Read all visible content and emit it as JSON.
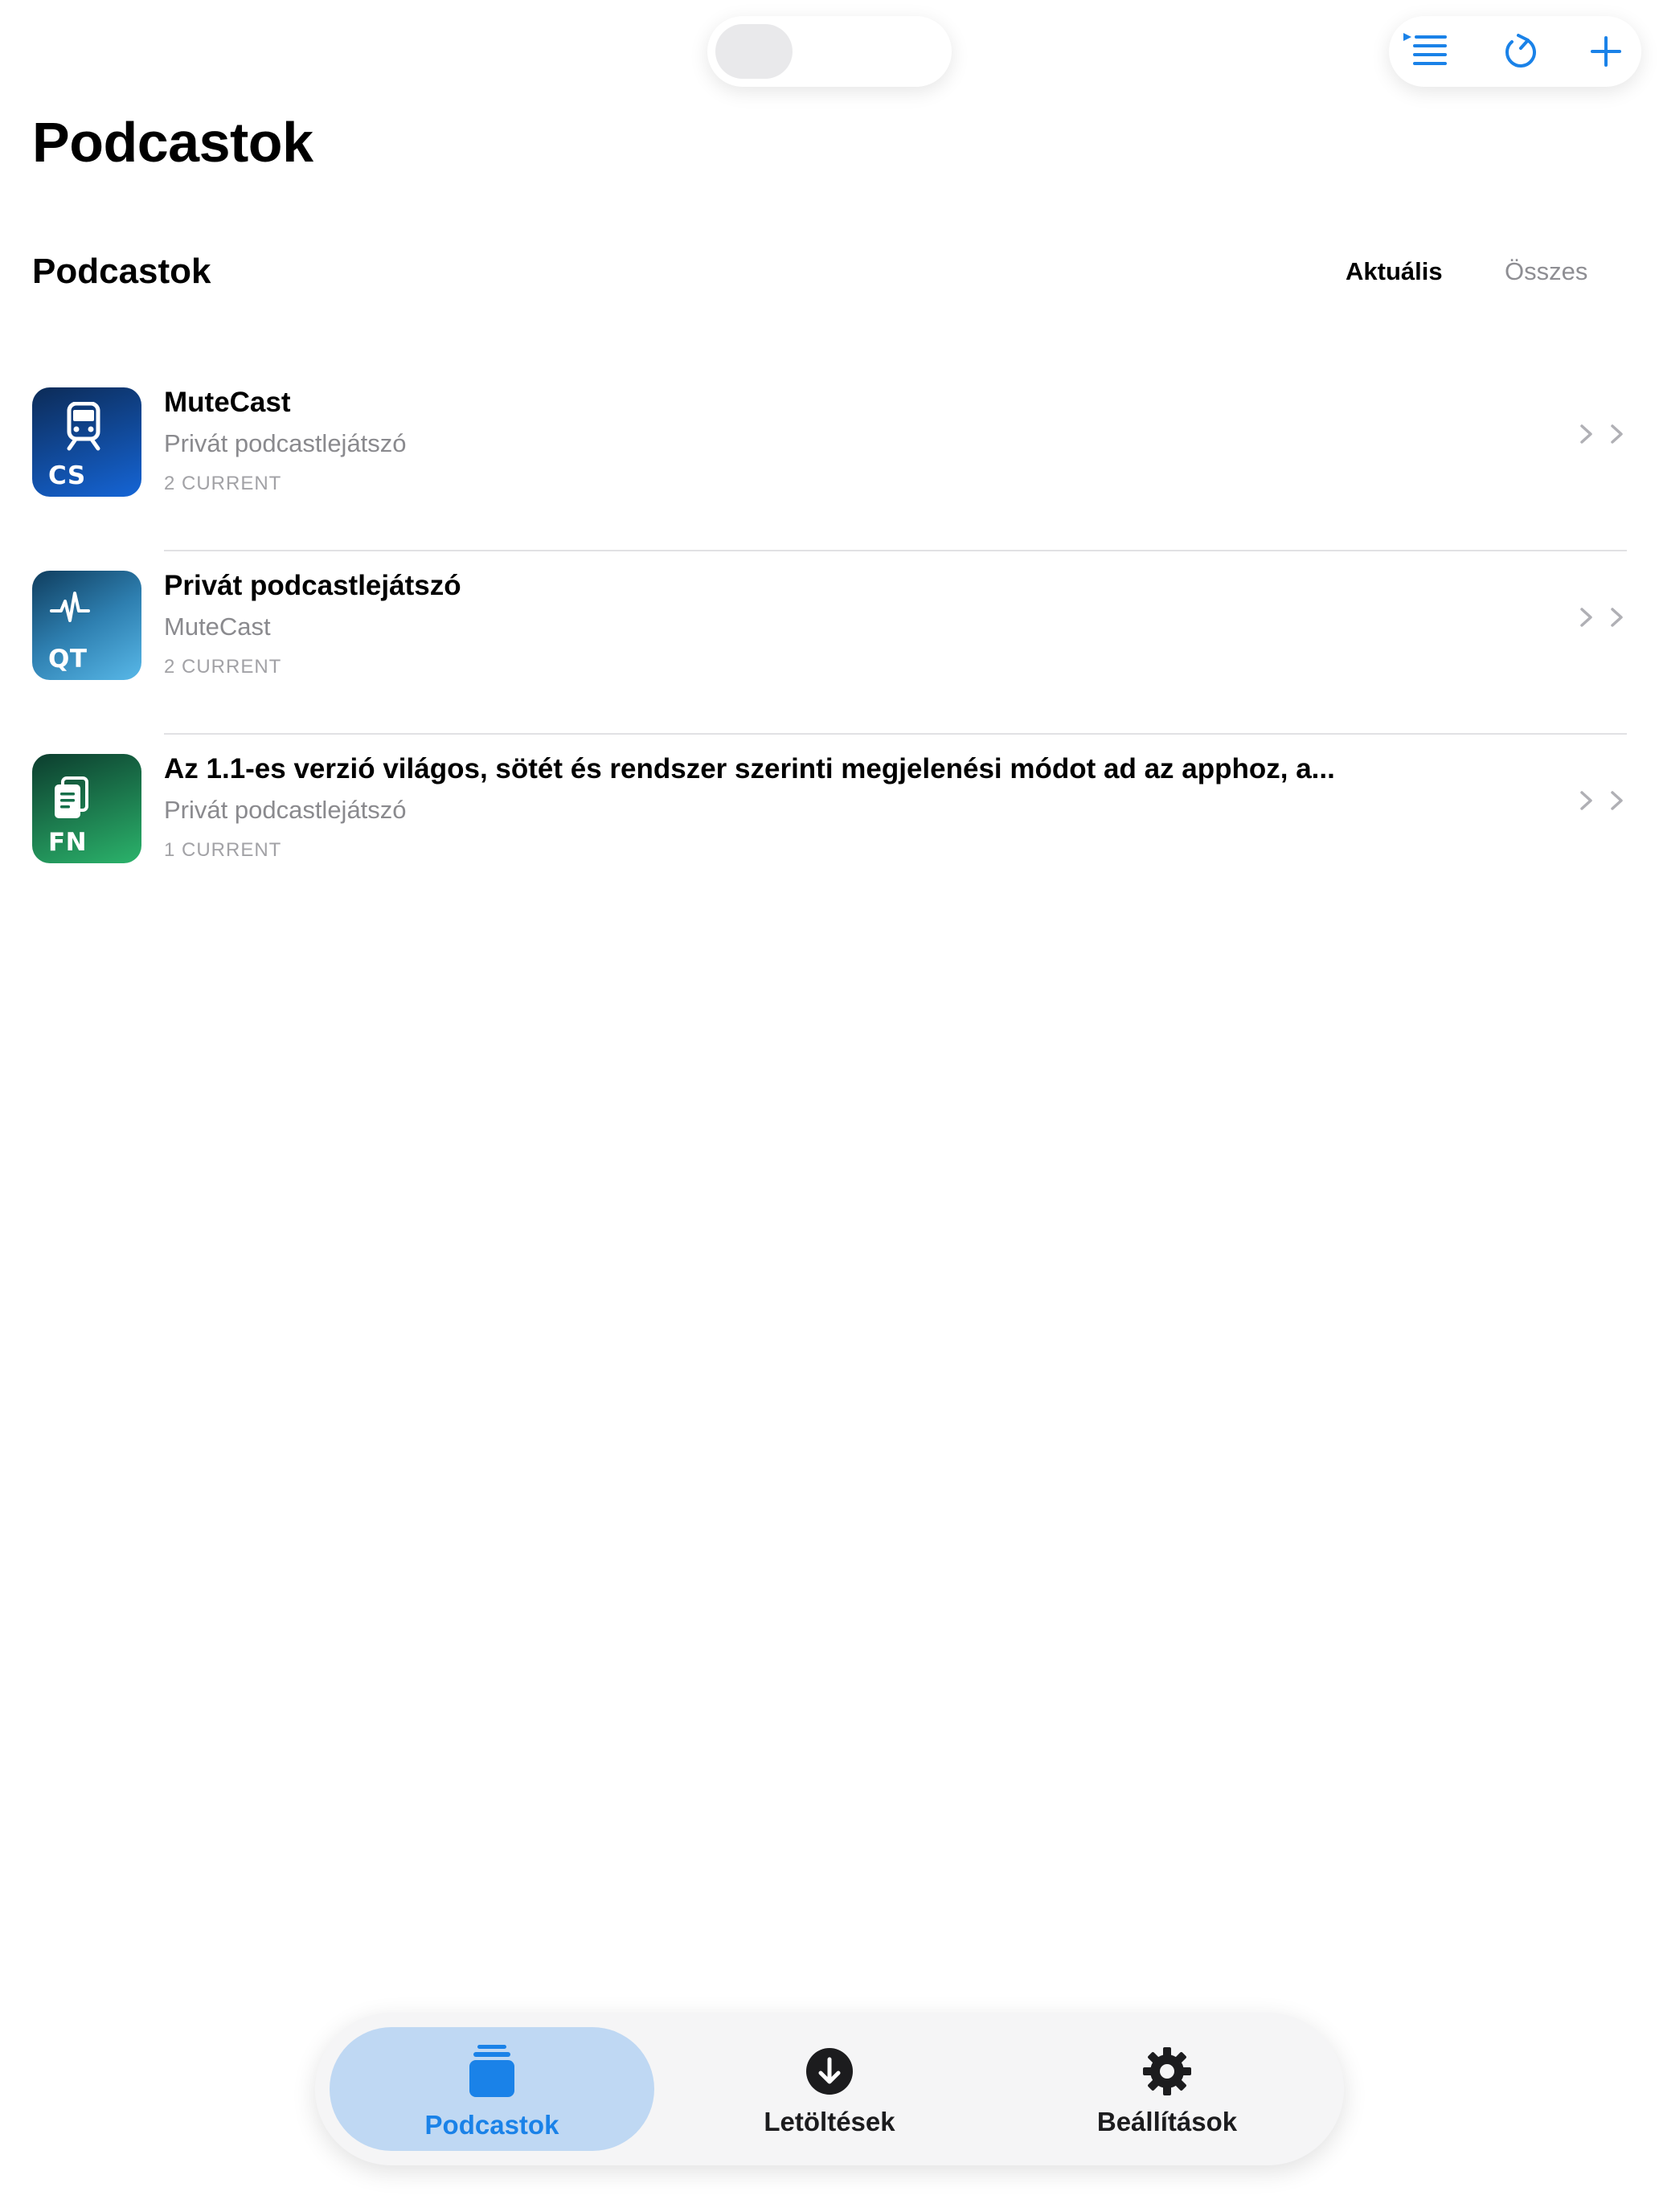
{
  "top_toggle": {
    "state": "off"
  },
  "toolbar": {
    "icons": [
      "playlist-icon",
      "refresh-icon",
      "plus-icon"
    ],
    "accent_color": "#1a82e8"
  },
  "header": {
    "title": "Podcastok"
  },
  "section": {
    "title": "Podcastok",
    "segments": [
      {
        "label": "Aktuális",
        "selected": true
      },
      {
        "label": "Összes",
        "selected": false
      }
    ]
  },
  "podcasts": [
    {
      "title": "MuteCast",
      "subtitle": "Privát podcastlejátszó",
      "count": "2 CURRENT",
      "art_code": "CS",
      "art_icon": "train-icon",
      "art_colors": [
        "#0c2b57",
        "#1565d6"
      ]
    },
    {
      "title": "Privát podcastlejátszó",
      "subtitle": "MuteCast",
      "count": "2 CURRENT",
      "art_code": "QT",
      "art_icon": "waveform-icon",
      "art_colors": [
        "#0f3d5e",
        "#58b8e8"
      ]
    },
    {
      "title": "Az 1.1-es verzió világos, sötét és rendszer szerinti megjelenési módot ad az apphoz, a...",
      "subtitle": "Privát podcastlejátszó",
      "count": "1 CURRENT",
      "art_code": "FN",
      "art_icon": "document-icon",
      "art_colors": [
        "#0c3d2e",
        "#2bb36b"
      ]
    }
  ],
  "tabbar": {
    "tabs": [
      {
        "label": "Podcastok",
        "icon": "stack-icon",
        "active": true
      },
      {
        "label": "Letöltések",
        "icon": "download-icon",
        "active": false
      },
      {
        "label": "Beállítások",
        "icon": "gear-icon",
        "active": false
      }
    ]
  }
}
